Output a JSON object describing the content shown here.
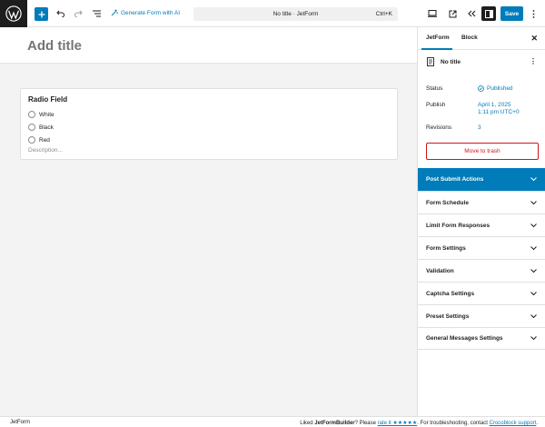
{
  "toolbar": {
    "generate_label": "Generate Form with AI",
    "doc_title": "No title · JetForm",
    "shortcut": "Ctrl+K",
    "save_label": "Save",
    "icons": [
      "wordpress-logo-icon",
      "plus-icon",
      "undo-icon",
      "redo-icon",
      "list-view-icon",
      "magic-wand-icon",
      "desktop-view-icon",
      "external-link-icon",
      "chevrons-left-icon",
      "sidebar-icon",
      "more-vertical-icon"
    ]
  },
  "editor": {
    "title_placeholder": "Add title",
    "block": {
      "label": "Radio Field",
      "options": [
        "White",
        "Black",
        "Red"
      ],
      "description": "Description..."
    }
  },
  "sidebar": {
    "tabs": [
      "JetForm",
      "Block"
    ],
    "doc_name": "No title",
    "status_label": "Status",
    "status_value": "Published",
    "publish_label": "Publish",
    "publish_date": "April 1, 2025",
    "publish_time": "1:11 pm UTC+0",
    "revisions_label": "Revisions",
    "revisions_value": "3",
    "trash_label": "Move to trash",
    "panels": [
      "Post Submit Actions",
      "Form Schedule",
      "Limit Form Responses",
      "Form Settings",
      "Validation",
      "Captcha Settings",
      "Preset Settings",
      "General Messages Settings"
    ]
  },
  "footer": {
    "left": "JetForm",
    "liked_prefix": "Liked ",
    "brand": "JetFormBuilder",
    "please": "? Please ",
    "rate_link": "rate it ★★★★★",
    "support_text": ". For troubleshooting, contact ",
    "support_link": "Crocoblock support",
    "end": "."
  },
  "colors": {
    "accent": "#007cba",
    "danger": "#cc1818",
    "dark": "#1e1e1e"
  }
}
